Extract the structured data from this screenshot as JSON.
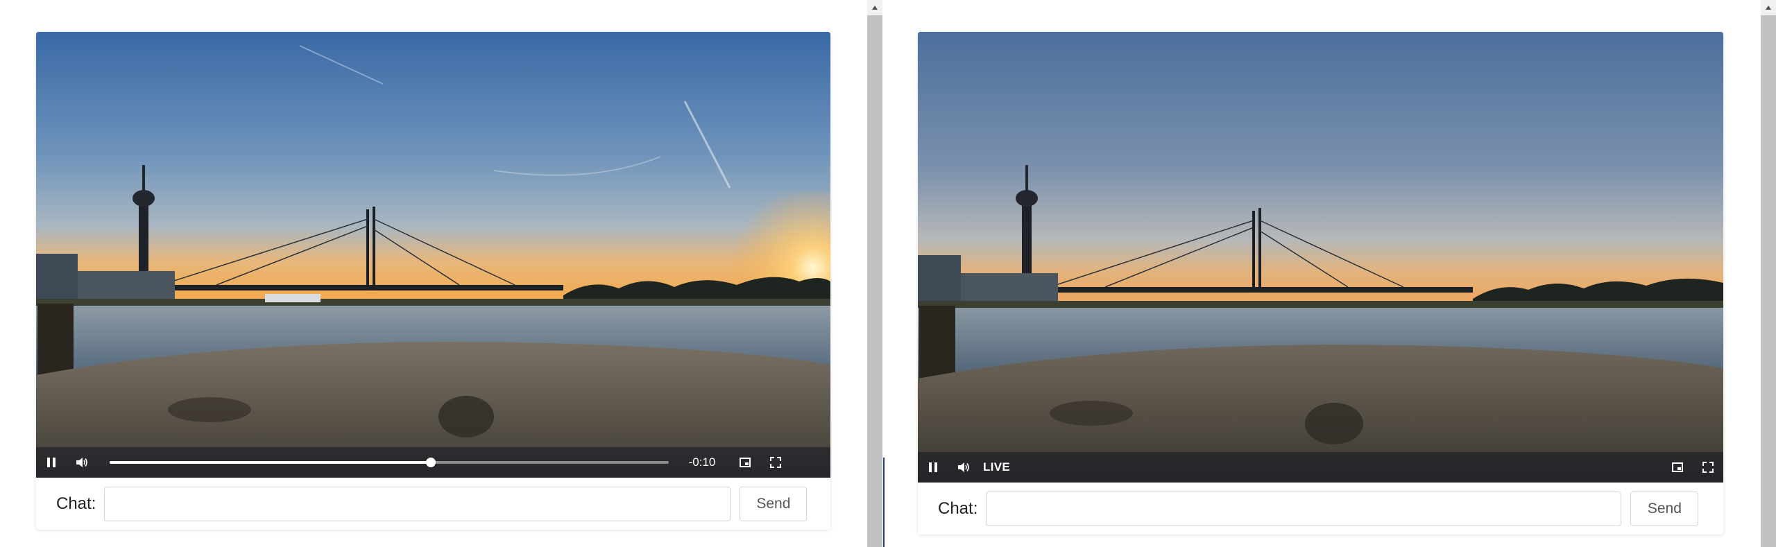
{
  "players": [
    {
      "id": "left",
      "controls": {
        "pause_icon": "pause-icon",
        "volume_icon": "volume-icon",
        "progress_fraction": 0.575,
        "time_remaining": "-0:10",
        "pip_icon": "picture-in-picture-icon",
        "fullscreen_icon": "fullscreen-icon"
      },
      "chat": {
        "label": "Chat:",
        "input_value": "",
        "placeholder": "",
        "send_label": "Send"
      }
    },
    {
      "id": "right",
      "controls": {
        "pause_icon": "pause-icon",
        "volume_icon": "volume-icon",
        "live_label": "LIVE",
        "pip_icon": "picture-in-picture-icon",
        "fullscreen_icon": "fullscreen-icon"
      },
      "chat": {
        "label": "Chat:",
        "input_value": "",
        "placeholder": "",
        "send_label": "Send"
      }
    }
  ],
  "colors": {
    "sky_top": "#3f6ea7",
    "sky_horizon": "#f2b56a",
    "water": "#6f8496",
    "stone": "#5e5a50",
    "controls_bg": "#141824",
    "divider_accent": "#27407a"
  }
}
